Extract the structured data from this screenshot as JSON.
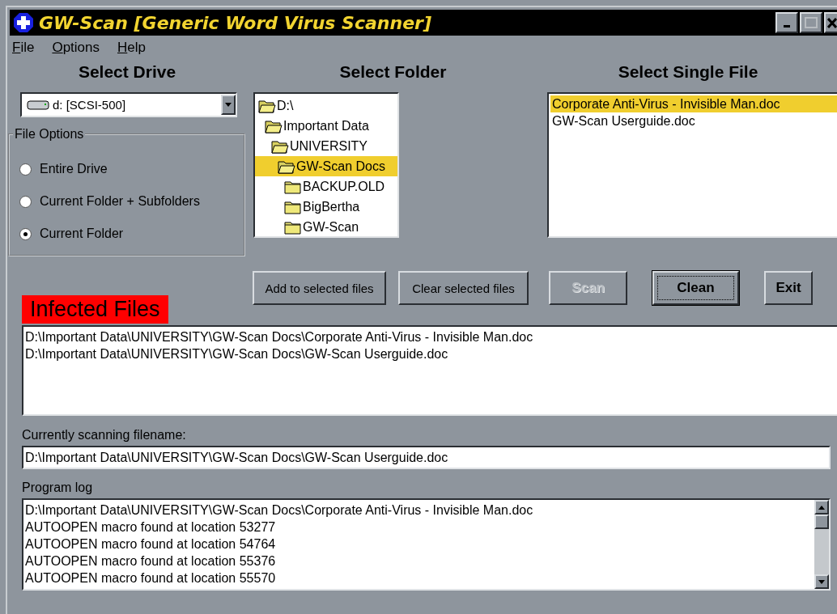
{
  "window": {
    "title": "GW-Scan [Generic Word Virus Scanner]"
  },
  "menu": [
    "File",
    "Options",
    "Help"
  ],
  "drive": {
    "heading": "Select Drive",
    "value": "d: [SCSI-500]"
  },
  "file_options": {
    "label": "File Options",
    "options": [
      {
        "label": "Entire Drive",
        "selected": false
      },
      {
        "label": "Current Folder + Subfolders",
        "selected": false
      },
      {
        "label": "Current Folder",
        "selected": true
      }
    ]
  },
  "folder": {
    "heading": "Select Folder",
    "tree": [
      {
        "label": "D:\\",
        "expanded": true,
        "selected": false,
        "children": [
          {
            "label": "Important Data",
            "expanded": true,
            "selected": false,
            "children": [
              {
                "label": "UNIVERSITY",
                "expanded": true,
                "selected": false,
                "children": [
                  {
                    "label": "GW-Scan Docs",
                    "expanded": true,
                    "selected": true,
                    "children": [
                      {
                        "label": "BACKUP.OLD",
                        "expanded": false,
                        "selected": false
                      },
                      {
                        "label": "BigBertha",
                        "expanded": false,
                        "selected": false
                      },
                      {
                        "label": "GW-Scan",
                        "expanded": false,
                        "selected": false
                      }
                    ]
                  }
                ]
              }
            ]
          }
        ]
      }
    ]
  },
  "single_file": {
    "heading": "Select Single File",
    "files": [
      {
        "label": "Corporate Anti-Virus - Invisible Man.doc",
        "selected": true
      },
      {
        "label": "GW-Scan Userguide.doc",
        "selected": false
      }
    ]
  },
  "buttons": [
    {
      "label": "Add to selected files",
      "disabled": false,
      "focused": false,
      "bold": false
    },
    {
      "label": "Clear selected files",
      "disabled": false,
      "focused": false,
      "bold": false
    },
    {
      "label": "Scan",
      "disabled": true,
      "focused": false,
      "bold": true
    },
    {
      "label": "Clean",
      "disabled": false,
      "focused": true,
      "bold": true
    },
    {
      "label": "Exit",
      "disabled": false,
      "focused": false,
      "bold": true
    }
  ],
  "infected": {
    "heading": "Infected Files",
    "files": [
      "D:\\Important Data\\UNIVERSITY\\GW-Scan Docs\\Corporate Anti-Virus - Invisible Man.doc",
      "D:\\Important Data\\UNIVERSITY\\GW-Scan Docs\\GW-Scan Userguide.doc"
    ]
  },
  "scanning": {
    "label": "Currently scanning filename:",
    "value": "D:\\Important Data\\UNIVERSITY\\GW-Scan Docs\\GW-Scan Userguide.doc"
  },
  "log": {
    "label": "Program log",
    "lines": [
      "D:\\Important Data\\UNIVERSITY\\GW-Scan Docs\\Corporate Anti-Virus - Invisible Man.doc",
      "AUTOOPEN macro found at location 53277",
      "AUTOOPEN macro found at location 54764",
      "AUTOOPEN macro found at location 55376",
      "AUTOOPEN macro found at location 55570"
    ]
  }
}
